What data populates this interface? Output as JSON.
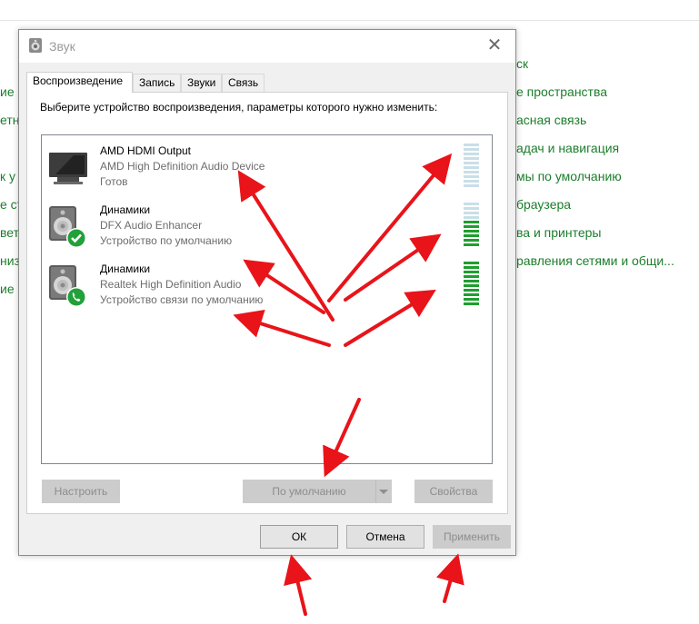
{
  "background": {
    "right_links": [
      "ск",
      "е пространства",
      "асная связь",
      "адач и навигация",
      "мы по умолчанию",
      "браузера",
      "ва и принтеры",
      "равления сетями и общи..."
    ],
    "left_links": [
      "ие",
      "етн",
      "к у",
      "е ст",
      "вет",
      "низ",
      "ие"
    ]
  },
  "dialog": {
    "title": "Звук",
    "close_glyph": "✕",
    "tabs": [
      {
        "label": "Воспроизведение",
        "active": true
      },
      {
        "label": "Запись",
        "active": false
      },
      {
        "label": "Звуки",
        "active": false
      },
      {
        "label": "Связь",
        "active": false
      }
    ],
    "instruction": "Выберите устройство воспроизведения, параметры которого нужно изменить:",
    "devices": [
      {
        "name": "AMD HDMI Output",
        "description": "AMD High Definition Audio Device",
        "status": "Готов",
        "icon": "monitor-icon",
        "meter_level": 0.0
      },
      {
        "name": "Динамики",
        "description": "DFX Audio Enhancer",
        "status": "Устройство по умолчанию",
        "icon": "speaker-default-check-icon",
        "meter_level": 0.6
      },
      {
        "name": "Динамики",
        "description": "Realtek High Definition Audio",
        "status": "Устройство связи по умолчанию",
        "icon": "speaker-phone-icon",
        "meter_level": 1.0
      }
    ],
    "buttons": {
      "configure": "Настроить",
      "set_default": "По умолчанию",
      "properties": "Свойства",
      "ok": "ОК",
      "cancel": "Отмена",
      "apply": "Применить"
    },
    "colors": {
      "meter_on": "#1f9e2f",
      "meter_off": "#c9dfe8",
      "link_green": "#1c7e2c",
      "annotation_arrow": "#e8141a"
    }
  }
}
